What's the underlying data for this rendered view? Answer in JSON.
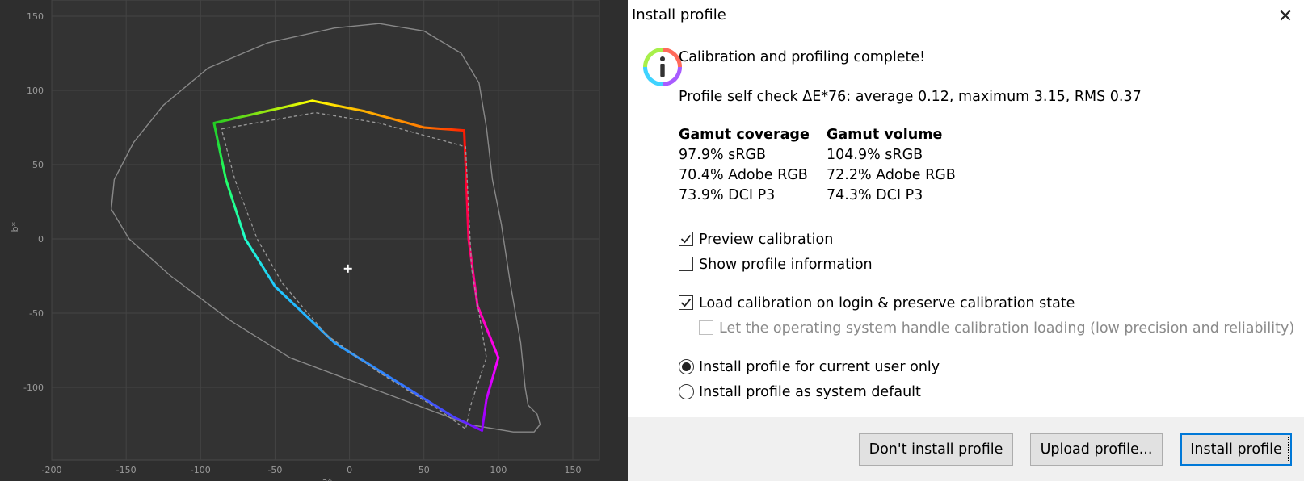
{
  "chart_data": {
    "type": "scatter",
    "xlabel": "a*",
    "ylabel": "b*",
    "xlim": [
      -210,
      170
    ],
    "ylim": [
      -145,
      155
    ],
    "x_ticks": [
      "-200",
      "-150",
      "-100",
      "-50",
      "0",
      "50",
      "100",
      "150"
    ],
    "y_ticks": [
      "150",
      "100",
      "50",
      "0",
      "-50",
      "-100"
    ],
    "grid": true,
    "whitepoint": [
      -1,
      -20
    ],
    "series": [
      {
        "style": "solid-outline-gray",
        "points": [
          [
            -160,
            20
          ],
          [
            -158,
            40
          ],
          [
            -145,
            65
          ],
          [
            -125,
            90
          ],
          [
            -95,
            115
          ],
          [
            -55,
            132
          ],
          [
            -10,
            142
          ],
          [
            20,
            145
          ],
          [
            50,
            140
          ],
          [
            75,
            125
          ],
          [
            87,
            105
          ],
          [
            92,
            75
          ],
          [
            96,
            40
          ],
          [
            102,
            10
          ],
          [
            108,
            -30
          ],
          [
            115,
            -70
          ],
          [
            118,
            -100
          ],
          [
            120,
            -112
          ],
          [
            126,
            -118
          ],
          [
            128,
            -125
          ],
          [
            124,
            -130
          ],
          [
            110,
            -130
          ],
          [
            80,
            -125
          ],
          [
            40,
            -110
          ],
          [
            0,
            -95
          ],
          [
            -40,
            -80
          ],
          [
            -80,
            -55
          ],
          [
            -120,
            -25
          ],
          [
            -148,
            0
          ],
          [
            -160,
            20
          ]
        ]
      },
      {
        "style": "gamut-colored",
        "points": [
          [
            -91,
            78
          ],
          [
            -25,
            93
          ],
          [
            10,
            86
          ],
          [
            50,
            75
          ],
          [
            77,
            73
          ],
          [
            78,
            50
          ],
          [
            80,
            0
          ],
          [
            86,
            -45
          ],
          [
            100,
            -80
          ],
          [
            92,
            -108
          ],
          [
            89,
            -129
          ],
          [
            70,
            -120
          ],
          [
            30,
            -95
          ],
          [
            -10,
            -70
          ],
          [
            -50,
            -32
          ],
          [
            -70,
            0
          ],
          [
            -83,
            40
          ],
          [
            -91,
            78
          ]
        ],
        "colors": [
          "#22cc22",
          "#ffff00",
          "#ffb000",
          "#ff7a00",
          "#ff2000",
          "#ff0020",
          "#ff0060",
          "#ff00aa",
          "#ff00ff",
          "#c000ff",
          "#8800ff",
          "#4a40ff",
          "#2f7fff",
          "#29a0ff",
          "#20c8ff",
          "#20ffcc",
          "#22ff66",
          "#22cc22"
        ]
      },
      {
        "style": "dashed-gray",
        "points": [
          [
            -86,
            74
          ],
          [
            -23,
            85
          ],
          [
            20,
            78
          ],
          [
            60,
            67
          ],
          [
            78,
            62
          ],
          [
            80,
            20
          ],
          [
            82,
            -20
          ],
          [
            92,
            -80
          ],
          [
            82,
            -110
          ],
          [
            78,
            -128
          ],
          [
            60,
            -115
          ],
          [
            20,
            -90
          ],
          [
            -15,
            -65
          ],
          [
            -45,
            -30
          ],
          [
            -62,
            0
          ],
          [
            -77,
            40
          ],
          [
            -86,
            74
          ]
        ]
      }
    ]
  },
  "dialog": {
    "title": "Install profile",
    "close_glyph": "✕",
    "heading": "Calibration and profiling complete!",
    "self_check": "Profile self check ΔE*76: average 0.12, maximum 3.15, RMS 0.37",
    "coverage_header": "Gamut coverage",
    "volume_header": "Gamut volume",
    "coverage": [
      "97.9% sRGB",
      "70.4% Adobe RGB",
      "73.9% DCI P3"
    ],
    "volume": [
      "104.9% sRGB",
      "72.2% Adobe RGB",
      "74.3% DCI P3"
    ],
    "preview_calibration": {
      "label": "Preview calibration",
      "checked": true
    },
    "show_profile_info": {
      "label": "Show profile information",
      "checked": false
    },
    "load_calibration": {
      "label": "Load calibration on login & preserve calibration state",
      "checked": true
    },
    "os_handle": {
      "label": "Let the operating system handle calibration loading (low precision and reliability)",
      "checked": false,
      "disabled": true
    },
    "radio_current_user": {
      "label": "Install profile for current user only",
      "selected": true
    },
    "radio_system_default": {
      "label": "Install profile as system default",
      "selected": false
    },
    "buttons": {
      "dont_install": "Don't install profile",
      "upload": "Upload profile...",
      "install": "Install profile"
    }
  }
}
